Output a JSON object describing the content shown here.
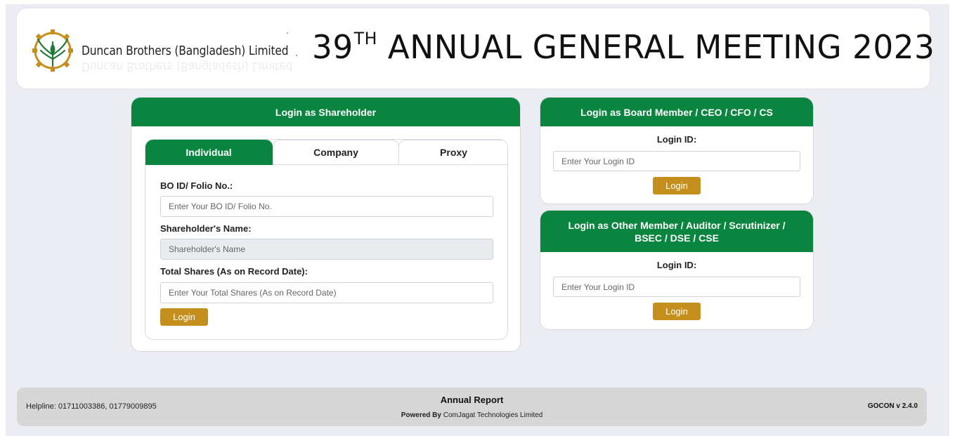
{
  "header": {
    "company_name": "Duncan Brothers (Bangladesh) Limited",
    "title_number": "39",
    "title_suffix": "TH",
    "title_text": "ANNUAL GENERAL MEETING 2023"
  },
  "shareholder_login": {
    "heading": "Login as Shareholder",
    "tabs": [
      {
        "label": "Individual",
        "active": true
      },
      {
        "label": "Company",
        "active": false
      },
      {
        "label": "Proxy",
        "active": false
      }
    ],
    "bo_id": {
      "label": "BO ID/ Folio No.:",
      "placeholder": "Enter Your BO ID/ Folio No.",
      "value": ""
    },
    "name": {
      "label": "Shareholder's Name:",
      "placeholder": "Shareholder's Name",
      "value": ""
    },
    "shares": {
      "label": "Total Shares (As on Record Date):",
      "placeholder": "Enter Your Total Shares (As on Record Date)",
      "value": ""
    },
    "login_button": "Login"
  },
  "board_login": {
    "heading": "Login as Board Member / CEO / CFO / CS",
    "login_id_label": "Login ID:",
    "login_id_placeholder": "Enter Your Login ID",
    "login_button": "Login"
  },
  "other_login": {
    "heading": "Login as Other Member / Auditor / Scrutinizer / BSEC / DSE / CSE",
    "login_id_label": "Login ID:",
    "login_id_placeholder": "Enter Your Login ID",
    "login_button": "Login"
  },
  "footer": {
    "helpline": "Helpline: 01711003386, 01779009895",
    "annual_report": "Annual Report",
    "powered_by_label": "Powered By",
    "powered_by_company": "ComJagat Technologies Limited",
    "version": "GOCON v 2.4.0"
  },
  "colors": {
    "brand_green": "#0a8540",
    "button_gold": "#c58f1d",
    "page_background": "#ecedf3",
    "footer_background": "#d6d6d6"
  },
  "icons": {
    "logo": "gear-leaf-emblem"
  }
}
